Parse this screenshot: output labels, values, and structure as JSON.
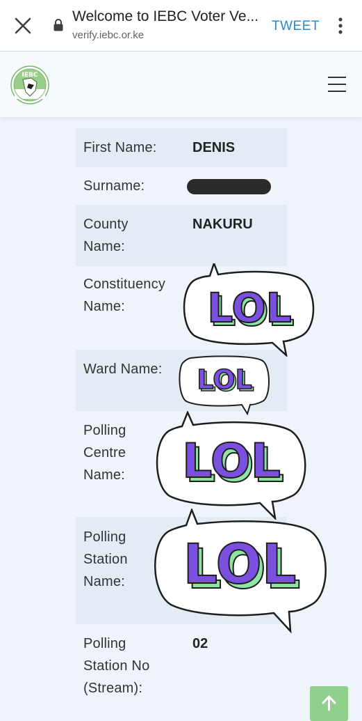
{
  "browser": {
    "title": "Welcome to IEBC Voter Ve...",
    "url": "verify.iebc.or.ke",
    "action_label": "TWEET",
    "icons": [
      "close-icon",
      "lock-icon",
      "more-vert-icon"
    ]
  },
  "site": {
    "logo_text": "IEBC",
    "menu_icon": "hamburger-menu-icon"
  },
  "record": [
    {
      "label": "First Name:",
      "value": "DENIS"
    },
    {
      "label": "Surname:",
      "value": ""
    },
    {
      "label": "County Name:",
      "value": "NAKURU"
    },
    {
      "label": "Constituency Name:",
      "value": ""
    },
    {
      "label": "Ward Name:",
      "value": ""
    },
    {
      "label": "Polling Centre Name:",
      "value": ""
    },
    {
      "label": "Polling Station Name:",
      "value": ""
    },
    {
      "label": "Polling Station No (Stream):",
      "value": "02"
    }
  ],
  "stickers": {
    "text": "LOL",
    "colors": {
      "fill": "#7b4fe0",
      "shadow": "#8fe3a5",
      "outline": "#1e1e1e",
      "bubble": "#ffffff"
    }
  },
  "scroll_top": {
    "icon": "arrow-up-icon",
    "color": "#8fd18c"
  }
}
